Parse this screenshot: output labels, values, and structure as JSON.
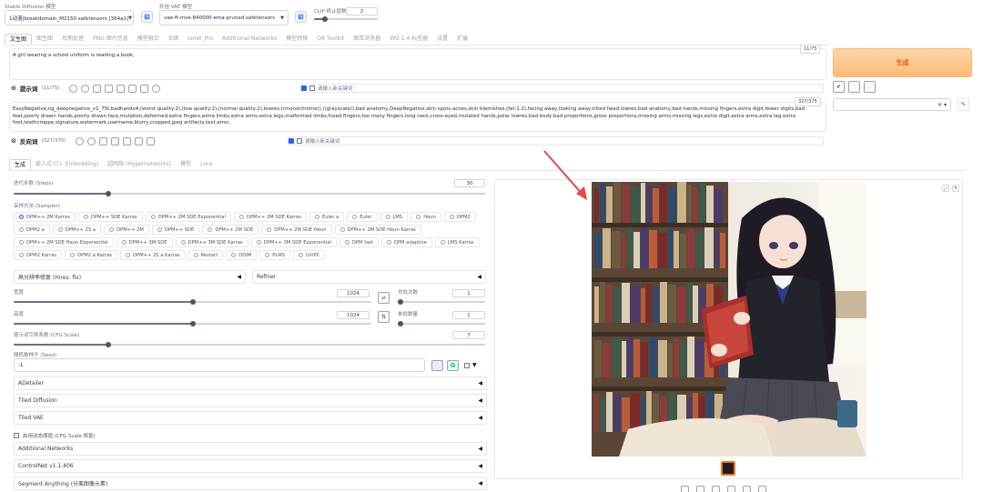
{
  "header": {
    "model_label": "Stable Diffusion 模型",
    "model_value": "1动漫|breakdomain_M2150.safetensors [364a1]",
    "vae_label": "外挂 VAE 模型",
    "vae_value": "vae-ft-mse-840000-ema-pruned.safetensors",
    "clip_label": "CLIP 终止层数",
    "clip_value": "2"
  },
  "main_tabs": [
    "文生图",
    "图生图",
    "后期处理",
    "PNG 图片信息",
    "模型融合",
    "训练",
    "Isnet_Pro",
    "Additional Networks",
    "模型转换",
    "QR Toolkit",
    "图库浏览器",
    "WD 1.4 标签器",
    "设置",
    "扩展"
  ],
  "prompt": {
    "text": "A girl wearing a school uniform is reading a book,",
    "counter": "11/75",
    "label": "提示词",
    "count": "(11/75)",
    "checkbox_label": "请输入新关键词"
  },
  "negative": {
    "text": "EasyNegative,ng_deepnegative_v1_75t,badhandv4,(worst quality:2),(low quality:2),(normal quality:2),lowres,((monochrome)),((grayscale)),bad anatomy,DeepNegative,skin spots,acnes,skin blemishes,(fat:1.2),facing away,looking away,tilted head,lowres,bad anatomy,bad hands,missing fingers,extra digit,fewer digits,bad feet,poorly drawn hands,poorly drawn face,mutation,deformed,extra fingers,extra limbs,extra arms,extra legs,malformed limbs,fused fingers,too many fingers,long neck,cross-eyed,mutated hands,polar lowres,bad body,bad proportions,gross proportions,missing arms,missing legs,extra digit,extra arms,extra leg,extra foot,teethcroppe,signature,watermark,username,blurry,cropped,jpeg artifacts,text,error,",
    "counter": "327/375",
    "label": "反向词",
    "count": "(327/375)",
    "checkbox_label": "请输入新关键词"
  },
  "generate_label": "生成",
  "sub_tabs": [
    "生成",
    "嵌入式 (T.I. Embedding)",
    "超网络 (Hypernetworks)",
    "模型",
    "Lora"
  ],
  "steps": {
    "label": "迭代步数 (Steps)",
    "value": "30",
    "fraction": 0.2
  },
  "sampler": {
    "label": "采样方法 (Sampler)",
    "selected": "DPM++ 2M Karras",
    "options": [
      "DPM++ 2M Karras",
      "DPM++ SDE Karras",
      "DPM++ 2M SDE Exponential",
      "DPM++ 2M SDE Karras",
      "Euler a",
      "Euler",
      "LMS",
      "Heun",
      "DPM2",
      "DPM2 a",
      "DPM++ 2S a",
      "DPM++ 2M",
      "DPM++ SDE",
      "DPM++ 2M SDE",
      "DPM++ 2M SDE Heun",
      "DPM++ 2M SDE Heun Karras",
      "DPM++ 2M SDE Heun Exponential",
      "DPM++ 3M SDE",
      "DPM++ 3M SDE Karras",
      "DPM++ 3M SDE Exponential",
      "DPM fast",
      "DPM adaptive",
      "LMS Karras",
      "DPM2 Karras",
      "DPM2 a Karras",
      "DPM++ 2S a Karras",
      "Restart",
      "DDIM",
      "PLMS",
      "UniPC"
    ]
  },
  "hires_label": "高分辨率修复 (Hires. fix)",
  "refiner_label": "Refiner",
  "width": {
    "label": "宽度",
    "value": "1024",
    "fraction": 0.5
  },
  "height": {
    "label": "高度",
    "value": "1024",
    "fraction": 0.5
  },
  "batch_count": {
    "label": "总批次数",
    "value": "1",
    "fraction": 0.0
  },
  "batch_size": {
    "label": "单批数量",
    "value": "1",
    "fraction": 0.0
  },
  "cfg": {
    "label": "提示词引导系数 (CFG Scale)",
    "value": "7",
    "fraction": 0.2
  },
  "seed": {
    "label": "随机数种子 (Seed)",
    "value": "-1"
  },
  "accordions_top": [
    "ADetailer",
    "Tiled Diffusion",
    "Tiled VAE"
  ],
  "cfg_checkbox_label": "启用动态阈值 (CFG Scale 修复)",
  "accordions_bottom": [
    "Additional Networks",
    "ControlNet v1.1.406",
    "Segment Anything (分离图像元素)"
  ],
  "colors": {
    "accent": "#2563eb",
    "generate": "#fdba74",
    "arrow": "#ef4444"
  }
}
